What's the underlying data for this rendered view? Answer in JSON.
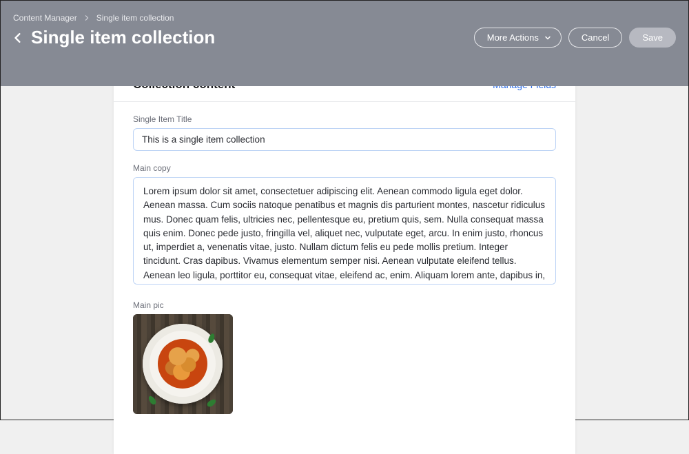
{
  "breadcrumb": {
    "root": "Content Manager",
    "current": "Single item collection"
  },
  "page": {
    "title": "Single item collection"
  },
  "actions": {
    "more": "More Actions",
    "cancel": "Cancel",
    "save": "Save"
  },
  "card": {
    "title": "Collection content",
    "manage_fields": "Manage Fields"
  },
  "fields": {
    "title_label": "Single Item Title",
    "title_value": "This is a single item collection",
    "main_copy_label": "Main copy",
    "main_copy_value": "Lorem ipsum dolor sit amet, consectetuer adipiscing elit. Aenean commodo ligula eget dolor. Aenean massa. Cum sociis natoque penatibus et magnis dis parturient montes, nascetur ridiculus mus. Donec quam felis, ultricies nec, pellentesque eu, pretium quis, sem. Nulla consequat massa quis enim. Donec pede justo, fringilla vel, aliquet nec, vulputate eget, arcu. In enim justo, rhoncus ut, imperdiet a, venenatis vitae, justo. Nullam dictum felis eu pede mollis pretium. Integer tincidunt. Cras dapibus. Vivamus elementum semper nisi. Aenean vulputate eleifend tellus. Aenean leo ligula, porttitor eu, consequat vitae, eleifend ac, enim. Aliquam lorem ante, dapibus in, viverra quis, feugiat a, tellus. Phasellus viverra nulla ut me",
    "main_pic_label": "Main pic"
  }
}
